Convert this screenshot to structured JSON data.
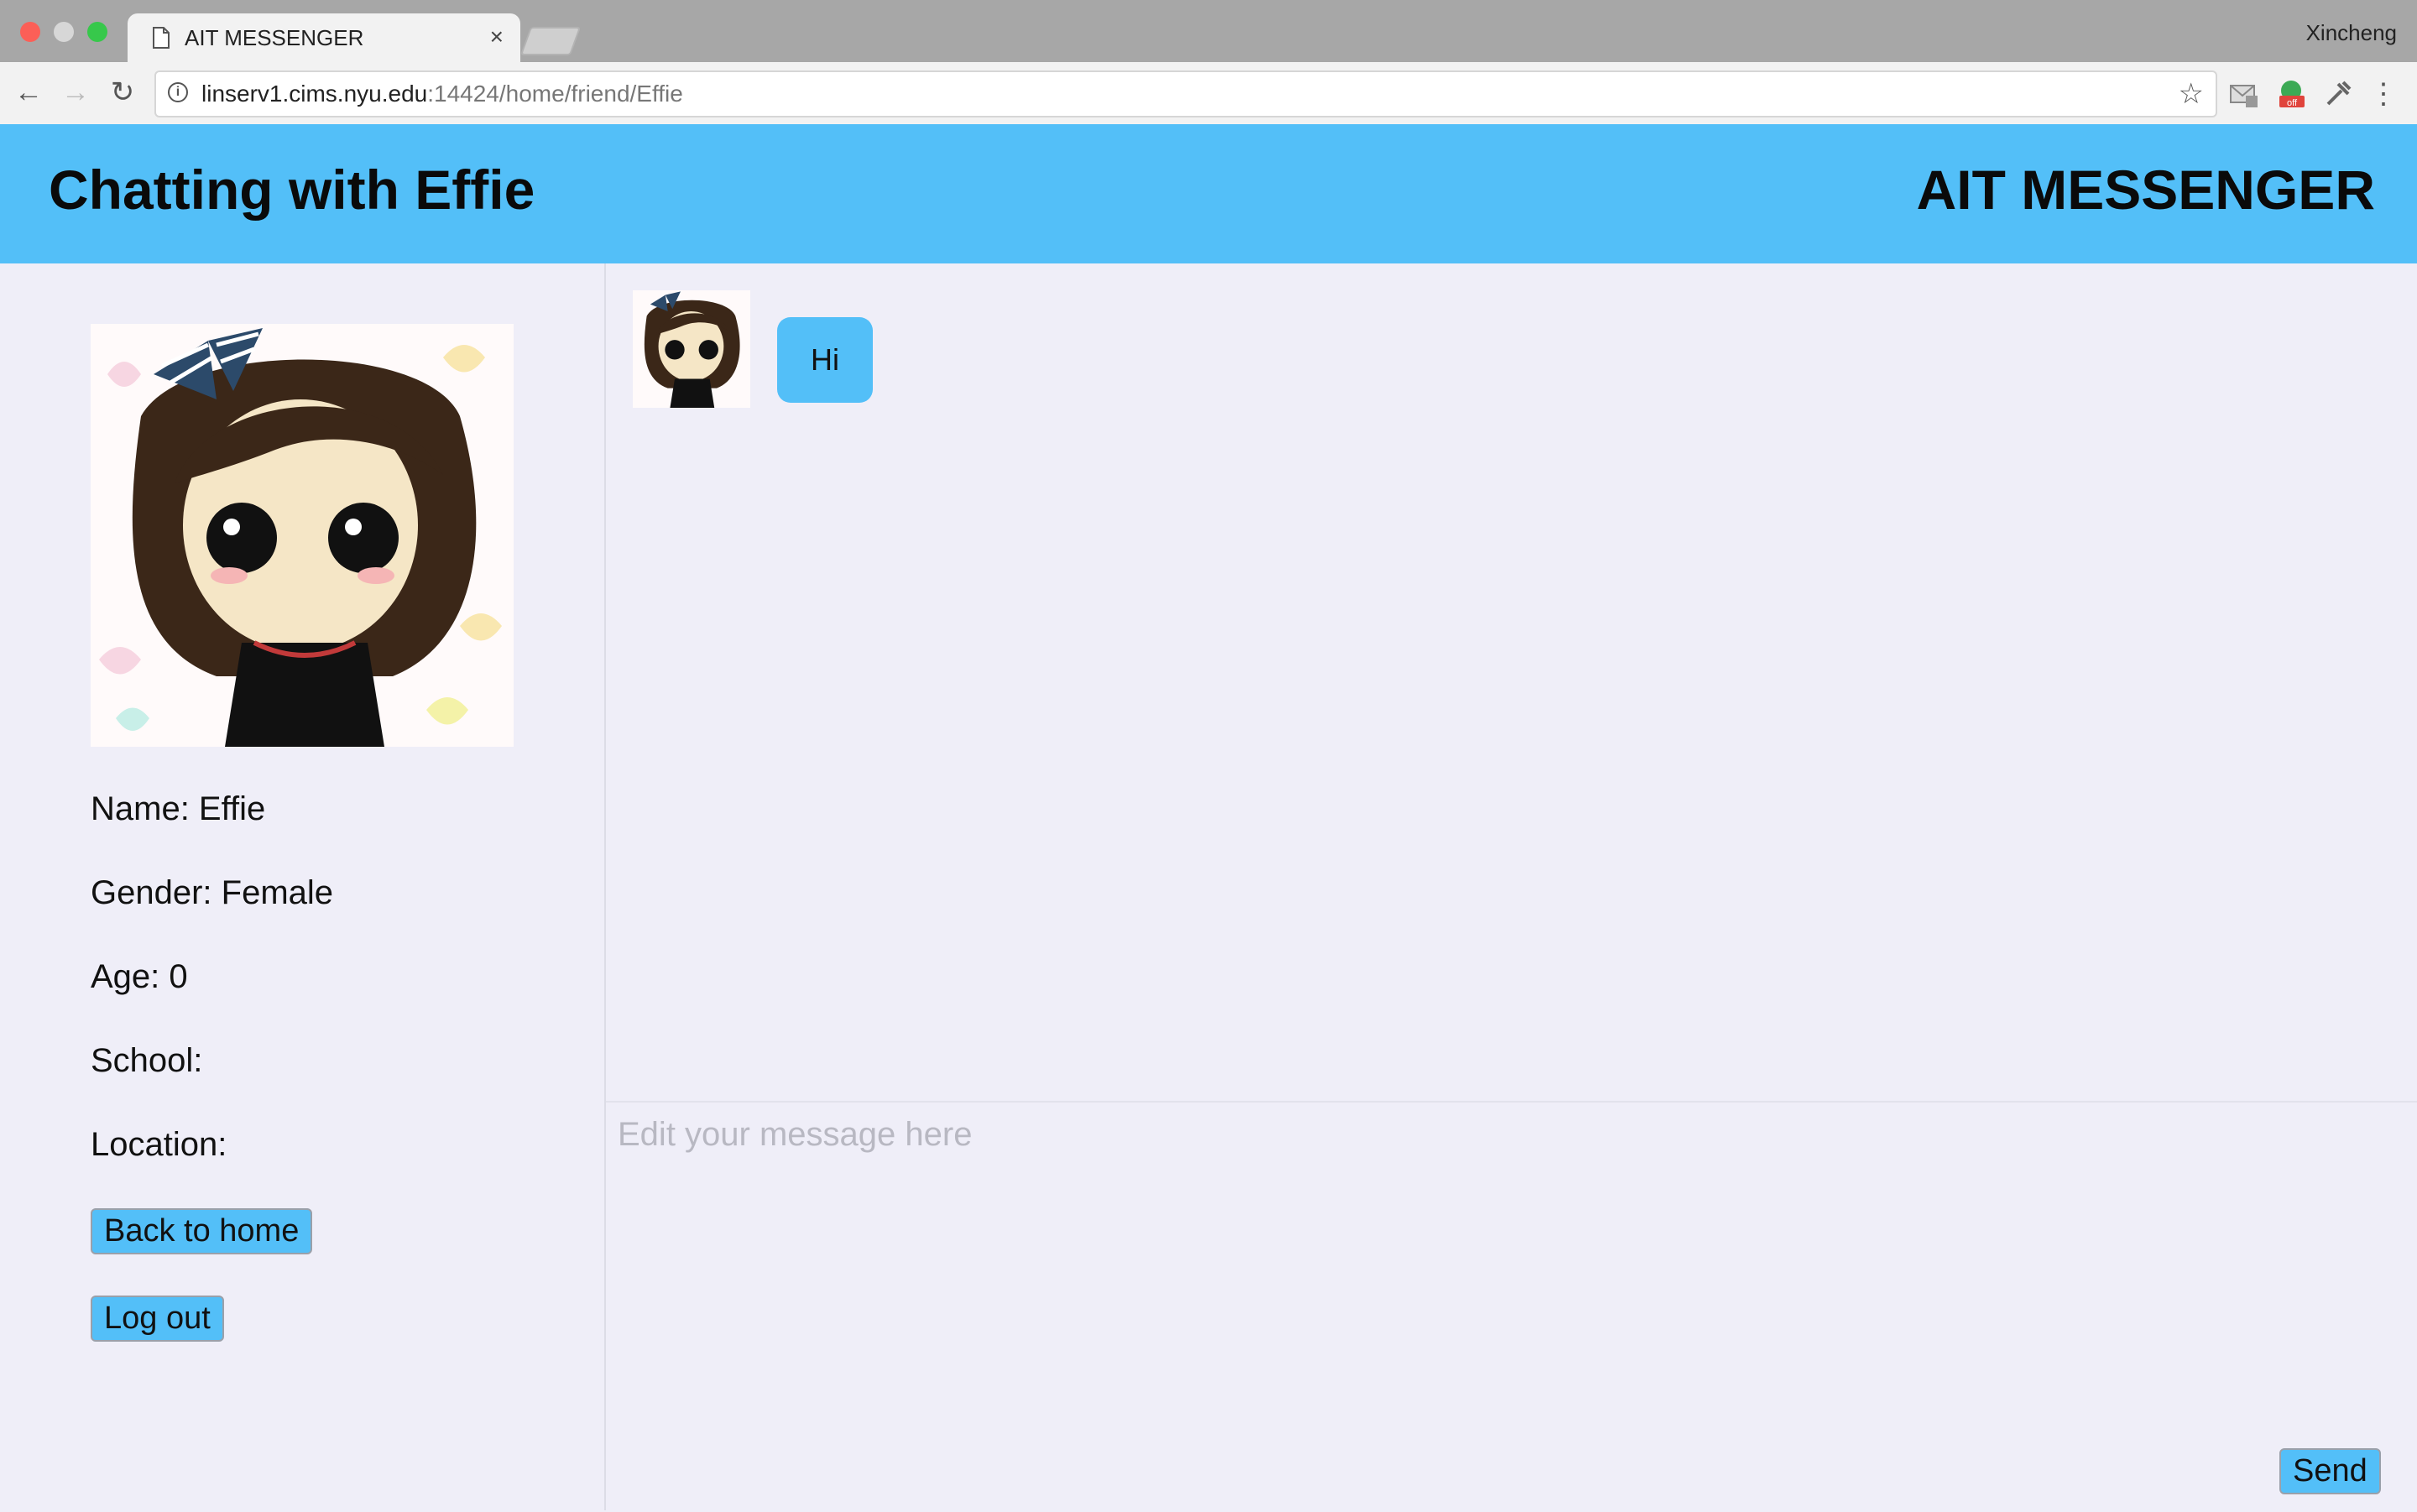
{
  "browser": {
    "tab_title": "AIT MESSENGER",
    "tab_close": "×",
    "profile_name": "Xincheng",
    "url_host": "linserv1.cims.nyu.edu",
    "url_rest": ":14424/home/friend/Effie"
  },
  "header": {
    "title": "Chatting with Effie",
    "brand": "AIT MESSENGER"
  },
  "profile": {
    "name": "Name: Effie",
    "gender": "Gender: Female",
    "age": "Age: 0",
    "school": "School:",
    "location": "Location:"
  },
  "buttons": {
    "back_home": "Back to home",
    "logout": "Log out",
    "send": "Send"
  },
  "messages": [
    {
      "text": "Hi"
    }
  ],
  "composer": {
    "placeholder": "Edit your message here",
    "value": ""
  },
  "colors": {
    "accent": "#53bff8",
    "background": "#efeef8"
  }
}
